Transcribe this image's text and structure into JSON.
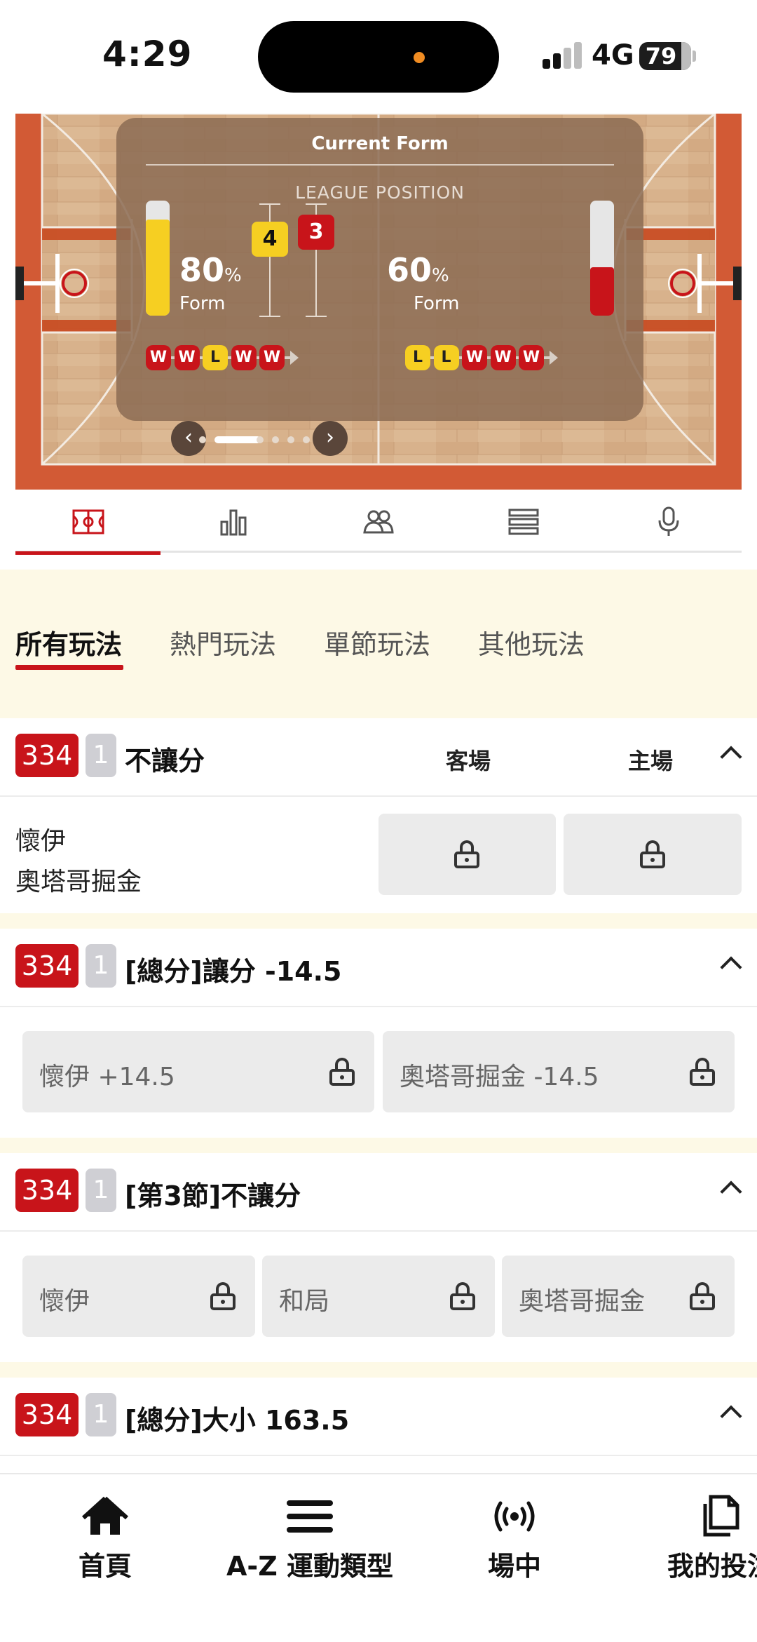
{
  "status_bar": {
    "time": "4:29",
    "network": "4G",
    "battery": "79"
  },
  "form_panel": {
    "title": "Current Form",
    "league_position_label": "LEAGUE POSITION",
    "home": {
      "form_pct": 80,
      "form_value": "80",
      "pct_sign": "%",
      "form_label": "Form",
      "position": "4",
      "results": [
        "W",
        "W",
        "L",
        "W",
        "W"
      ]
    },
    "away": {
      "form_pct": 60,
      "form_value": "60",
      "pct_sign": "%",
      "form_label": "Form",
      "position": "3",
      "results": [
        "L",
        "L",
        "W",
        "W",
        "W"
      ]
    },
    "carousel": {
      "pages": 7,
      "active": 1
    }
  },
  "icon_tabs": [
    {
      "icon": "basketball-court-icon",
      "active": true
    },
    {
      "icon": "bar-chart-icon",
      "active": false
    },
    {
      "icon": "players-icon",
      "active": false
    },
    {
      "icon": "list-icon",
      "active": false
    },
    {
      "icon": "microphone-icon",
      "active": false
    }
  ],
  "category_tabs": [
    "所有玩法",
    "熱門玩法",
    "單節玩法",
    "其他玩法"
  ],
  "markets": [
    {
      "number": "334",
      "sub": "1",
      "title": "不讓分",
      "col_away": "客場",
      "col_home": "主場",
      "teams": [
        "懷伊",
        "奧塔哥掘金"
      ]
    },
    {
      "number": "334",
      "sub": "1",
      "title": "[總分]讓分 -14.5",
      "options": [
        "懷伊 +14.5",
        "奧塔哥掘金 -14.5"
      ]
    },
    {
      "number": "334",
      "sub": "1",
      "title": "[第3節]不讓分",
      "options": [
        "懷伊",
        "和局",
        "奧塔哥掘金"
      ]
    },
    {
      "number": "334",
      "sub": "1",
      "title": "[總分]大小 163.5"
    }
  ],
  "bottom_nav": [
    {
      "label": "首頁",
      "icon": "home-icon"
    },
    {
      "label": "A-Z 運動類型",
      "icon": "menu-icon"
    },
    {
      "label": "場中",
      "icon": "live-broadcast-icon"
    },
    {
      "label": "我的投注",
      "icon": "my-bets-icon"
    }
  ],
  "colors": {
    "accent_red": "#c8141a",
    "loss_yellow": "#f6cf22",
    "cream_bg": "#fdf9e6",
    "court_wood": "#d7b08a"
  }
}
